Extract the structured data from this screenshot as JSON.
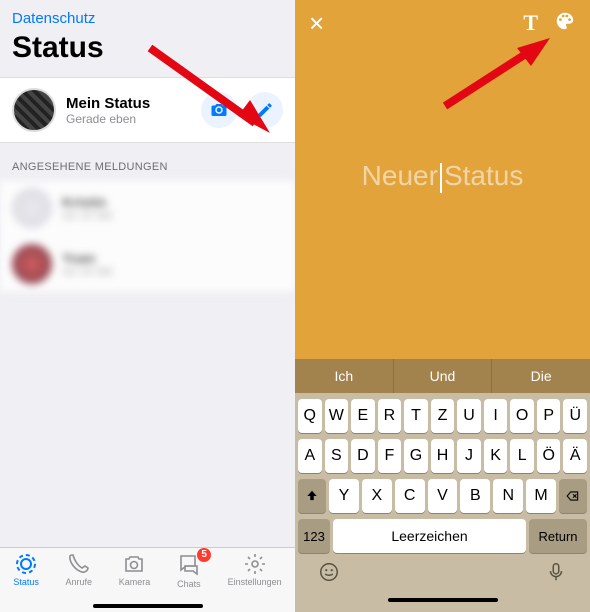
{
  "left": {
    "privacy": "Datenschutz",
    "title": "Status",
    "myStatus": {
      "title": "Mein Status",
      "subtitle": "Gerade eben"
    },
    "sectionViewed": "ANGESEHENE MELDUNGEN",
    "viewed": [
      {
        "name": "Kristin",
        "time": "vor 15 Std"
      },
      {
        "name": "Yuan",
        "time": "vor 23 Std"
      }
    ],
    "tabs": {
      "status": "Status",
      "calls": "Anrufe",
      "camera": "Kamera",
      "chats": "Chats",
      "settings": "Einstellungen",
      "chatBadge": "5"
    }
  },
  "right": {
    "placeholder1": "Neuer",
    "placeholder2": "Status",
    "suggestions": [
      "Ich",
      "Und",
      "Die"
    ],
    "rows": [
      [
        "Q",
        "W",
        "E",
        "R",
        "T",
        "Z",
        "U",
        "I",
        "O",
        "P",
        "Ü"
      ],
      [
        "A",
        "S",
        "D",
        "F",
        "G",
        "H",
        "J",
        "K",
        "L",
        "Ö",
        "Ä"
      ],
      [
        "Y",
        "X",
        "C",
        "V",
        "B",
        "N",
        "M"
      ]
    ],
    "numKey": "123",
    "space": "Leerzeichen",
    "return": "Return"
  }
}
